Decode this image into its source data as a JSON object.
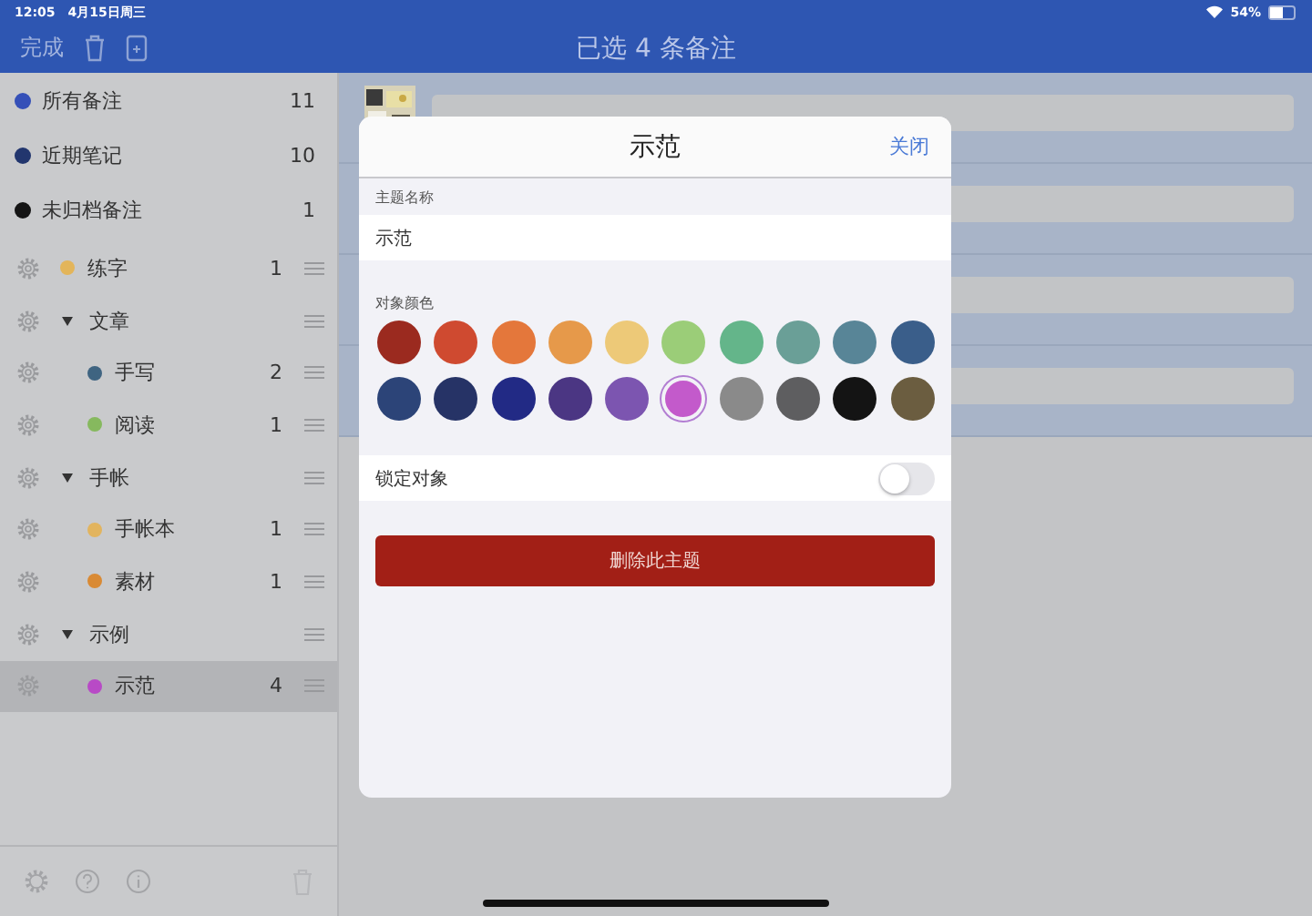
{
  "status_bar": {
    "time": "12:05",
    "date": "4月15日周三",
    "battery": "54%"
  },
  "nav_bar": {
    "done": "完成",
    "title": "已选 4 条备注"
  },
  "sidebar": {
    "items": [
      {
        "name": "所有备注",
        "count": "11",
        "color": "#3550b8",
        "selected": false
      },
      {
        "name": "近期笔记",
        "count": "10",
        "color": "#22366e",
        "selected": false
      },
      {
        "name": "未归档备注",
        "count": "1",
        "color": "#151515",
        "selected": false
      }
    ],
    "tags": [
      {
        "kind": "tag",
        "name": "练字",
        "count": "1",
        "color": "#e3b55a",
        "selected": false
      },
      {
        "kind": "group",
        "name": "文章",
        "expanded": true,
        "selected": false,
        "children": [
          {
            "kind": "tag",
            "name": "手写",
            "count": "2",
            "color": "#3f6481",
            "selected": false
          },
          {
            "kind": "tag",
            "name": "阅读",
            "count": "1",
            "color": "#86b95e",
            "selected": false
          }
        ]
      },
      {
        "kind": "group",
        "name": "手帐",
        "expanded": true,
        "selected": false,
        "children": [
          {
            "kind": "tag",
            "name": "手帐本",
            "count": "1",
            "color": "#e2b45e",
            "selected": false
          },
          {
            "kind": "tag",
            "name": "素材",
            "count": "1",
            "color": "#d98a34",
            "selected": false
          }
        ]
      },
      {
        "kind": "group",
        "name": "示例",
        "expanded": true,
        "selected": false,
        "children": [
          {
            "kind": "tag",
            "name": "示范",
            "count": "4",
            "color": "#b84ac6",
            "selected": true
          }
        ]
      }
    ]
  },
  "dialog": {
    "title": "示范",
    "close": "关闭",
    "name_label": "主题名称",
    "name_value": "示范",
    "color_label": "对象颜色",
    "colors": [
      {
        "color": "#9b2a1f",
        "selected": false
      },
      {
        "color": "#cf4a30",
        "selected": false
      },
      {
        "color": "#e4773b",
        "selected": false
      },
      {
        "color": "#e6994a",
        "selected": false
      },
      {
        "color": "#edc978",
        "selected": false
      },
      {
        "color": "#9bcd78",
        "selected": false
      },
      {
        "color": "#64b58a",
        "selected": false
      },
      {
        "color": "#6a9f97",
        "selected": false
      },
      {
        "color": "#588597",
        "selected": false
      },
      {
        "color": "#3a5e8a",
        "selected": false
      },
      {
        "color": "#2c4478",
        "selected": false
      },
      {
        "color": "#263366",
        "selected": false
      },
      {
        "color": "#222a85",
        "selected": false
      },
      {
        "color": "#4b3683",
        "selected": false
      },
      {
        "color": "#7c55b0",
        "selected": false
      },
      {
        "color": "#c35acb",
        "selected": true
      },
      {
        "color": "#8a8a8a",
        "selected": false
      },
      {
        "color": "#5e5e60",
        "selected": false
      },
      {
        "color": "#141414",
        "selected": false
      },
      {
        "color": "#6b5d40",
        "selected": false
      }
    ],
    "lock_label": "锁定对象",
    "lock_on": false,
    "delete": "删除此主题"
  }
}
